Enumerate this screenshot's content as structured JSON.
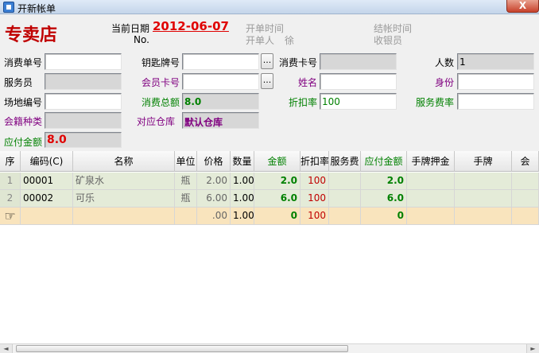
{
  "window": {
    "title": "开新帐单",
    "close_label": "X"
  },
  "header": {
    "store_name": "专卖店",
    "date_label": "当前日期",
    "date_value": "2012-06-07",
    "no_label": "No.",
    "open_time_label": "开单时间",
    "opener_label": "开单人",
    "opener_value": "徐",
    "checkout_time_label": "结帐时间",
    "cashier_label": "收银员"
  },
  "form": {
    "consume_no_label": "消费单号",
    "consume_no_value": "",
    "key_no_label": "钥匙牌号",
    "key_no_value": "",
    "consume_card_label": "消费卡号",
    "consume_card_value": "",
    "people_label": "人数",
    "people_value": "1",
    "waiter_label": "服务员",
    "waiter_value": "",
    "member_card_label": "会员卡号",
    "member_card_value": "",
    "name_label": "姓名",
    "name_value": "",
    "identity_label": "身份",
    "identity_value": "",
    "venue_label": "场地编号",
    "venue_value": "",
    "total_label": "消费总额",
    "total_value": "8.0",
    "discount_label": "折扣率",
    "discount_value": "100",
    "service_rate_label": "服务费率",
    "service_rate_value": "",
    "member_type_label": "会籍种类",
    "member_type_value": "",
    "warehouse_label": "对应仓库",
    "warehouse_value": "默认仓库",
    "payable_label": "应付金额",
    "payable_value": "8.0",
    "dots_label": "..."
  },
  "grid": {
    "columns": [
      "序",
      "编码(C)",
      "名称",
      "单位",
      "价格",
      "数量",
      "金额",
      "折扣率",
      "服务费",
      "应付金额",
      "手牌押金",
      "手牌",
      "会"
    ],
    "rows": [
      {
        "seq": "1",
        "code": "00001",
        "name": "矿泉水",
        "unit": "瓶",
        "price": "2.00",
        "qty": "1.00",
        "amount": "2.0",
        "discount": "100",
        "service": "",
        "payable": "2.0",
        "deposit": "",
        "hand": "",
        "extra": ""
      },
      {
        "seq": "2",
        "code": "00002",
        "name": "可乐",
        "unit": "瓶",
        "price": "6.00",
        "qty": "1.00",
        "amount": "6.0",
        "discount": "100",
        "service": "",
        "payable": "6.0",
        "deposit": "",
        "hand": "",
        "extra": ""
      },
      {
        "seq": "☞",
        "code": "",
        "name": "",
        "unit": "",
        "price": ".00",
        "qty": "1.00",
        "amount": "0",
        "discount": "100",
        "service": "",
        "payable": "0",
        "deposit": "",
        "hand": "",
        "extra": ""
      }
    ]
  },
  "colors": {
    "accent_red": "#e00000",
    "label_green": "#008000",
    "label_purple": "#800080",
    "row_alt": "#e4ebd8",
    "row_current": "#f9e4bd"
  }
}
